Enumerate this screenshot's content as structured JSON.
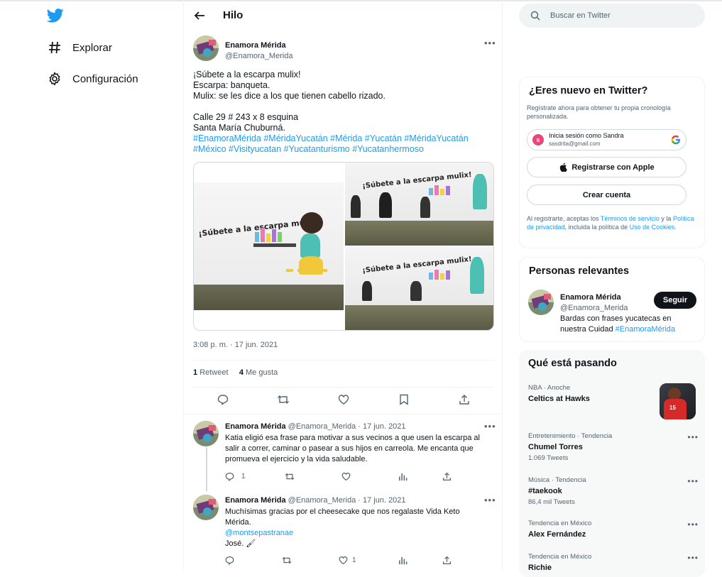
{
  "nav": {
    "logo_icon": "twitter-bird-icon",
    "items": [
      {
        "label": "Explorar",
        "icon": "hashtag-icon"
      },
      {
        "label": "Configuración",
        "icon": "gear-icon"
      }
    ]
  },
  "thread": {
    "title": "Hilo",
    "tweet": {
      "author_name": "Enamora Mérida",
      "author_handle": "@Enamora_Merida",
      "text_plain": "¡Súbete a la escarpa mulix!\nEscarpa: banqueta.\nMulix: se les dice a los que tienen cabello rizado.\n\nCalle 29 # 243 x 8 esquina\nSanta María Chuburná.\n",
      "hashtags_line1": "#EnamoraMérida #MéridaYucatán #Mérida #Yucatán #MéridaYucatán",
      "hashtags_line2": "#México #Visityucatan #Yucatanturismo #Yucatanhermoso",
      "media_text": "¡Súbete a la escarpa mulix!",
      "timestamp": "3:08 p. m. · 17 jun. 2021",
      "retweets_count": "1",
      "retweets_label": "Retweet",
      "likes_count": "4",
      "likes_label": "Me gusta"
    },
    "replies": [
      {
        "author_name": "Enamora Mérida",
        "author_handle": "@Enamora_Merida",
        "date": "· 17 jun. 2021",
        "text": "Katia eligió esa frase para motivar a sus vecinos a que usen la escarpa al salir a correr, caminar o pasear a sus hijos en carreola. Me encanta que promueva el ejercicio y la vida saludable.",
        "reply_count": "1"
      },
      {
        "author_name": "Enamora Mérida",
        "author_handle": "@Enamora_Merida",
        "date": "· 17 jun. 2021",
        "text": "Muchísimas gracias por el cheesecake que nos regalaste Vida Keto Mérida.",
        "mention": "@montsepastranae",
        "text2": "José. 🖌",
        "like_count": "1"
      }
    ]
  },
  "search": {
    "placeholder": "Buscar en Twitter"
  },
  "signup": {
    "title": "¿Eres nuevo en Twitter?",
    "subtitle": "Regístrate ahora para obtener tu propia cronología personalizada.",
    "google_name": "Inicia sesión como Sandra",
    "google_email": "sasdrita@gmail.com",
    "google_initial": "s",
    "apple_label": "Registrarse con Apple",
    "create_label": "Crear cuenta",
    "terms_1": "Al registrarte, aceptas los ",
    "terms_link1": "Términos de servicio",
    "terms_2": " y la ",
    "terms_link2": "Política de privacidad",
    "terms_3": ", incluida la política de ",
    "terms_link3": "Uso de Cookies",
    "terms_4": "."
  },
  "relevant": {
    "title": "Personas relevantes",
    "name": "Enamora Mérida",
    "handle": "@Enamora_Merida",
    "bio": "Bardas con frases yucatecas en nuestra Cuidad ",
    "bio_tag": "#EnamoraMérida",
    "follow_label": "Seguir"
  },
  "trends": {
    "title": "Qué está pasando",
    "items": [
      {
        "category": "NBA · Anoche",
        "title": "Celtics at Hawks",
        "count": ""
      },
      {
        "category": "Entretenimiento · Tendencia",
        "title": "Chumel Torres",
        "count": "1.069 Tweets"
      },
      {
        "category": "Música · Tendencia",
        "title": "#taekook",
        "count": "86,4 mil Tweets"
      },
      {
        "category": "Tendencia en México",
        "title": "Alex Fernández",
        "count": ""
      },
      {
        "category": "Tendencia en México",
        "title": "Richie",
        "count": ""
      }
    ]
  },
  "colors": {
    "accent": "#1d9bf0",
    "text": "#0f1419",
    "muted": "#536471"
  }
}
